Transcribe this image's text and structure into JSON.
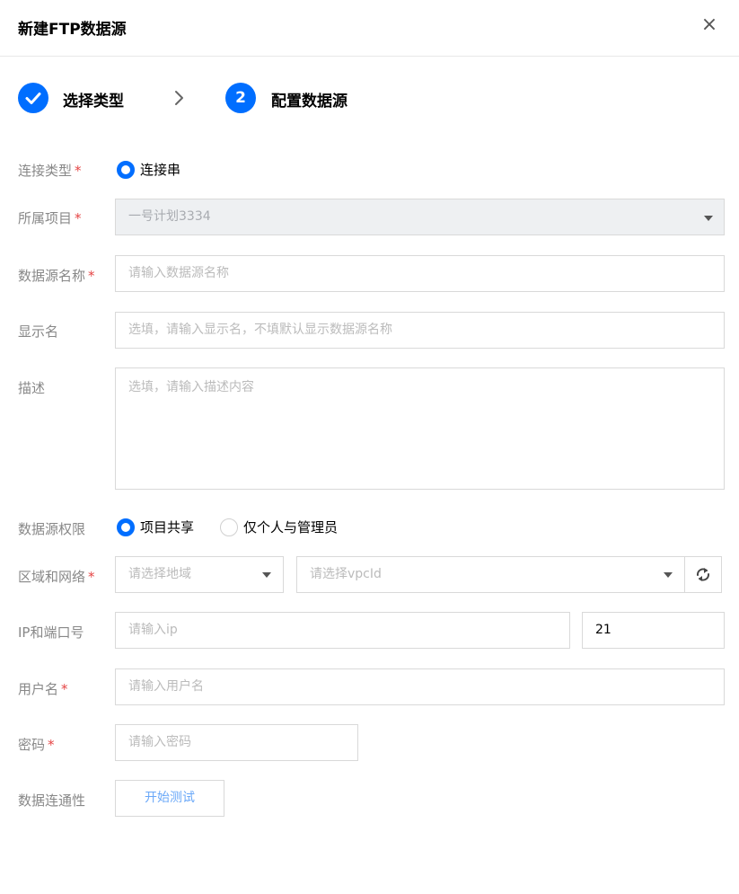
{
  "dialog": {
    "title": "新建FTP数据源",
    "close_icon": "×"
  },
  "steps": [
    {
      "index": "✓",
      "label": "选择类型",
      "status": "done"
    },
    {
      "index": "2",
      "label": "配置数据源",
      "status": "active"
    }
  ],
  "colors": {
    "primary": "#006eff",
    "required": "#e54545",
    "border": "#d9d9d9",
    "disabled_bg": "#eef0f2",
    "link": "#6aa8f8"
  },
  "form": {
    "conn_type": {
      "label": "连接类型",
      "required": "*",
      "option": "连接串",
      "selected": true
    },
    "project": {
      "label": "所属项目",
      "required": "*",
      "value": "一号计划3334",
      "disabled": true
    },
    "ds_name": {
      "label": "数据源名称",
      "required": "*",
      "placeholder": "请输入数据源名称"
    },
    "display_name": {
      "label": "显示名",
      "placeholder": "选填，请输入显示名，不填默认显示数据源名称"
    },
    "desc": {
      "label": "描述",
      "placeholder": "选填，请输入描述内容"
    },
    "permission": {
      "label": "数据源权限",
      "options": [
        "项目共享",
        "仅个人与管理员"
      ],
      "selected": "项目共享"
    },
    "region": {
      "label": "区域和网络",
      "required": "*",
      "region_placeholder": "请选择地域",
      "vpc_placeholder": "请选择vpcId"
    },
    "ipport": {
      "label": "IP和端口号",
      "ip_placeholder": "请输入ip",
      "port": "21"
    },
    "username": {
      "label": "用户名",
      "required": "*",
      "placeholder": "请输入用户名"
    },
    "password": {
      "label": "密码",
      "required": "*",
      "placeholder": "请输入密码"
    },
    "connectivity": {
      "label": "数据连通性",
      "button": "开始测试"
    }
  }
}
